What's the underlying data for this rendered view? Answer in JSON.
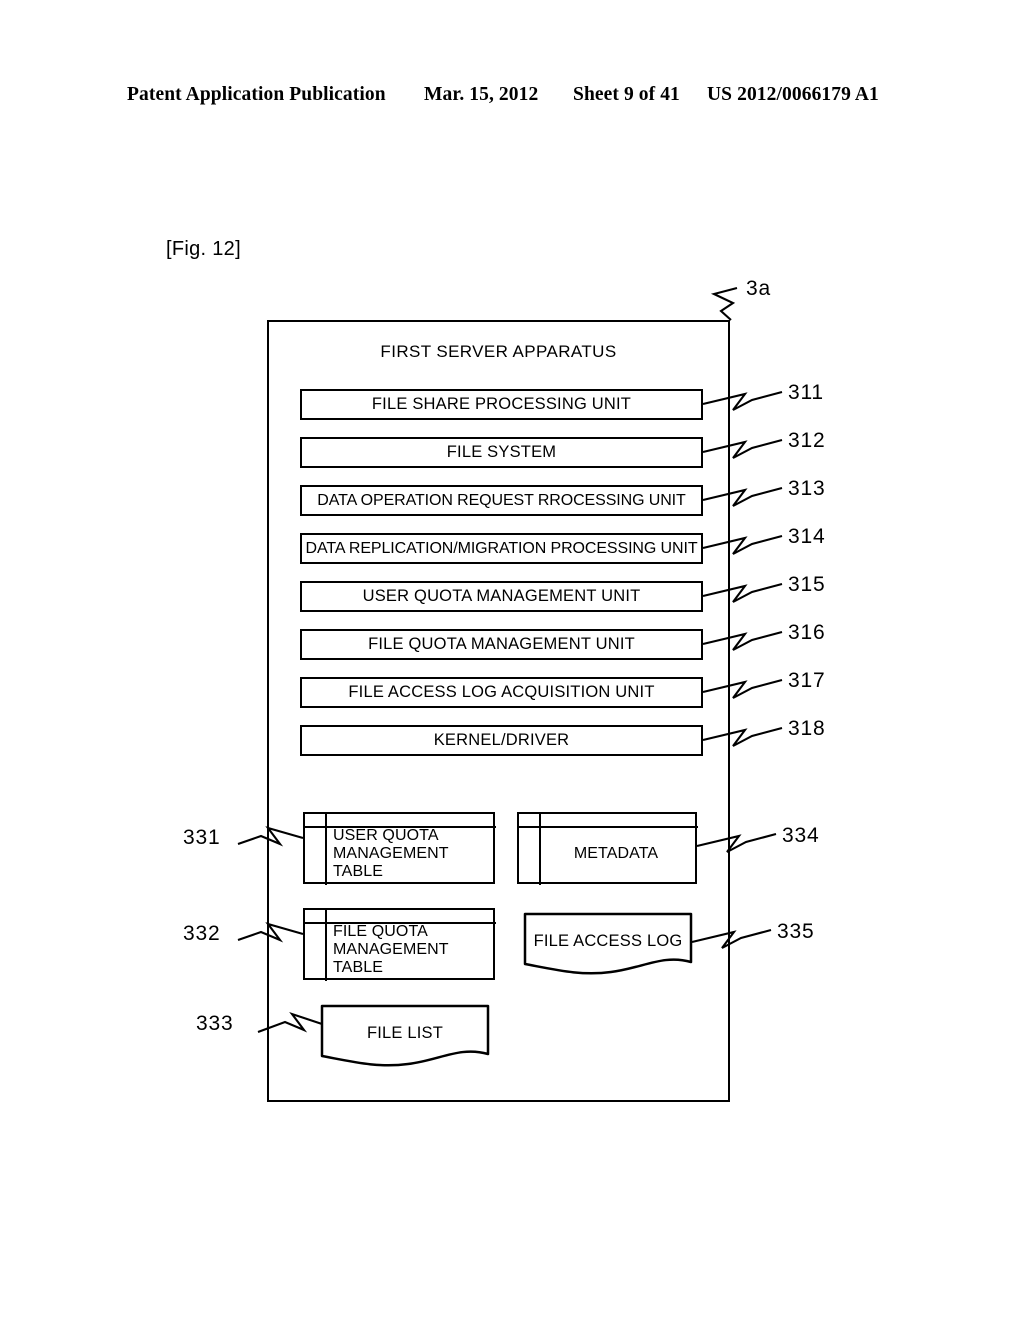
{
  "header": {
    "publication": "Patent Application Publication",
    "date": "Mar. 15, 2012",
    "sheet": "Sheet 9 of 41",
    "patent_number": "US 2012/0066179 A1"
  },
  "figure": {
    "label": "[Fig. 12]",
    "apparatus_ref": "3a",
    "title": "FIRST SERVER APPARATUS"
  },
  "units": [
    {
      "label": "FILE SHARE PROCESSING UNIT",
      "ref": "311"
    },
    {
      "label": "FILE SYSTEM",
      "ref": "312"
    },
    {
      "label": "DATA OPERATION REQUEST RROCESSING UNIT",
      "ref": "313"
    },
    {
      "label": "DATA REPLICATION/MIGRATION PROCESSING UNIT",
      "ref": "314"
    },
    {
      "label": "USER QUOTA MANAGEMENT UNIT",
      "ref": "315"
    },
    {
      "label": "FILE QUOTA MANAGEMENT UNIT",
      "ref": "316"
    },
    {
      "label": "FILE ACCESS LOG ACQUISITION UNIT",
      "ref": "317"
    },
    {
      "label": "KERNEL/DRIVER",
      "ref": "318"
    }
  ],
  "stores": [
    {
      "name": "user-quota-management-table",
      "shape": "table",
      "ref": "331",
      "ref_side": "left",
      "line1": "USER QUOTA",
      "line2": "MANAGEMENT",
      "line3": "TABLE"
    },
    {
      "name": "file-quota-management-table",
      "shape": "table",
      "ref": "332",
      "ref_side": "left",
      "line1": "FILE QUOTA",
      "line2": "MANAGEMENT",
      "line3": "TABLE"
    },
    {
      "name": "file-list",
      "shape": "document",
      "ref": "333",
      "ref_side": "left",
      "label": "FILE LIST"
    },
    {
      "name": "metadata",
      "shape": "table",
      "ref": "334",
      "ref_side": "right",
      "label": "METADATA"
    },
    {
      "name": "file-access-log",
      "shape": "document",
      "ref": "335",
      "ref_side": "right",
      "label": "FILE ACCESS LOG"
    }
  ],
  "colors": {
    "ink": "#000000",
    "paper": "#ffffff"
  }
}
